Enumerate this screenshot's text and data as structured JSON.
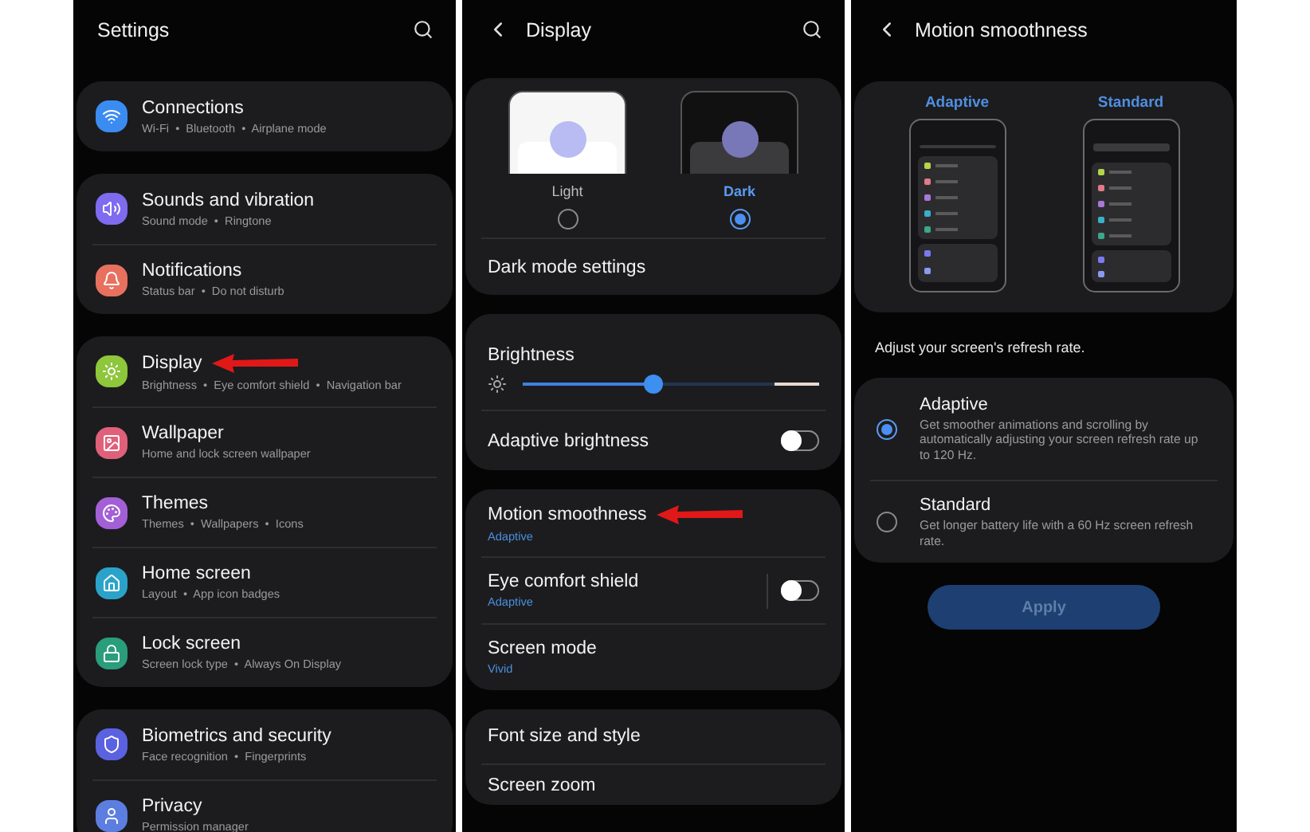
{
  "screens": [
    {
      "kind": "settings",
      "title": "Settings",
      "groups": [
        [
          {
            "kind": "wifi",
            "color": "#3b8cf0",
            "title": "Connections",
            "subtitle": "Wi-Fi  •  Bluetooth  •  Airplane mode",
            "arrow": false
          }
        ],
        [
          {
            "kind": "volume",
            "color": "#7d6cf0",
            "title": "Sounds and vibration",
            "subtitle": "Sound mode  •  Ringtone",
            "arrow": false
          },
          {
            "kind": "bell",
            "color": "#e8705f",
            "title": "Notifications",
            "subtitle": "Status bar  •  Do not disturb",
            "arrow": false
          }
        ],
        [
          {
            "kind": "sun",
            "color": "#8ec63c",
            "title": "Display",
            "subtitle": "Brightness  •  Eye comfort shield  •  Navigation bar",
            "arrow": true
          },
          {
            "kind": "image",
            "color": "#e0607a",
            "title": "Wallpaper",
            "subtitle": "Home and lock screen wallpaper",
            "arrow": false
          },
          {
            "kind": "palette",
            "color": "#a35fd6",
            "title": "Themes",
            "subtitle": "Themes  •  Wallpapers  •  Icons",
            "arrow": false
          },
          {
            "kind": "home",
            "color": "#2ba3c9",
            "title": "Home screen",
            "subtitle": "Layout  •  App icon badges",
            "arrow": false
          },
          {
            "kind": "lock",
            "color": "#2a9d7a",
            "title": "Lock screen",
            "subtitle": "Screen lock type  •  Always On Display",
            "arrow": false
          }
        ],
        [
          {
            "kind": "shield",
            "color": "#5a62e0",
            "title": "Biometrics and security",
            "subtitle": "Face recognition  •  Fingerprints",
            "arrow": false
          },
          {
            "kind": "user",
            "color": "#5b7ee0",
            "title": "Privacy",
            "subtitle": "Permission manager",
            "arrow": false
          }
        ]
      ]
    },
    {
      "kind": "display",
      "title": "Display",
      "themes": [
        {
          "label": "Light",
          "selected": false
        },
        {
          "label": "Dark",
          "selected": true
        }
      ],
      "dark_mode_settings": "Dark mode settings",
      "brightness": {
        "label": "Brightness",
        "level": 0.44
      },
      "adaptive_brightness": {
        "label": "Adaptive brightness",
        "on": false
      },
      "rows": [
        {
          "title": "Motion smoothness",
          "subtitle": "Adaptive",
          "arrow": true,
          "kind": "plain"
        },
        {
          "title": "Eye comfort shield",
          "subtitle": "Adaptive",
          "arrow": false,
          "kind": "toggle",
          "on": false
        },
        {
          "title": "Screen mode",
          "subtitle": "Vivid",
          "arrow": false,
          "kind": "plain"
        }
      ],
      "more": [
        "Font size and style",
        "Screen zoom"
      ]
    },
    {
      "kind": "motion",
      "title": "Motion smoothness",
      "previews": [
        "Adaptive",
        "Standard"
      ],
      "description": "Adjust your screen's refresh rate.",
      "options": [
        {
          "title": "Adaptive",
          "text": "Get smoother animations and scrolling by automatically adjusting your screen refresh rate up to 120 Hz.",
          "selected": true
        },
        {
          "title": "Standard",
          "text": "Get longer battery life with a 60 Hz screen refresh rate.",
          "selected": false
        }
      ],
      "apply": {
        "label": "Apply",
        "disabled": true
      }
    }
  ]
}
